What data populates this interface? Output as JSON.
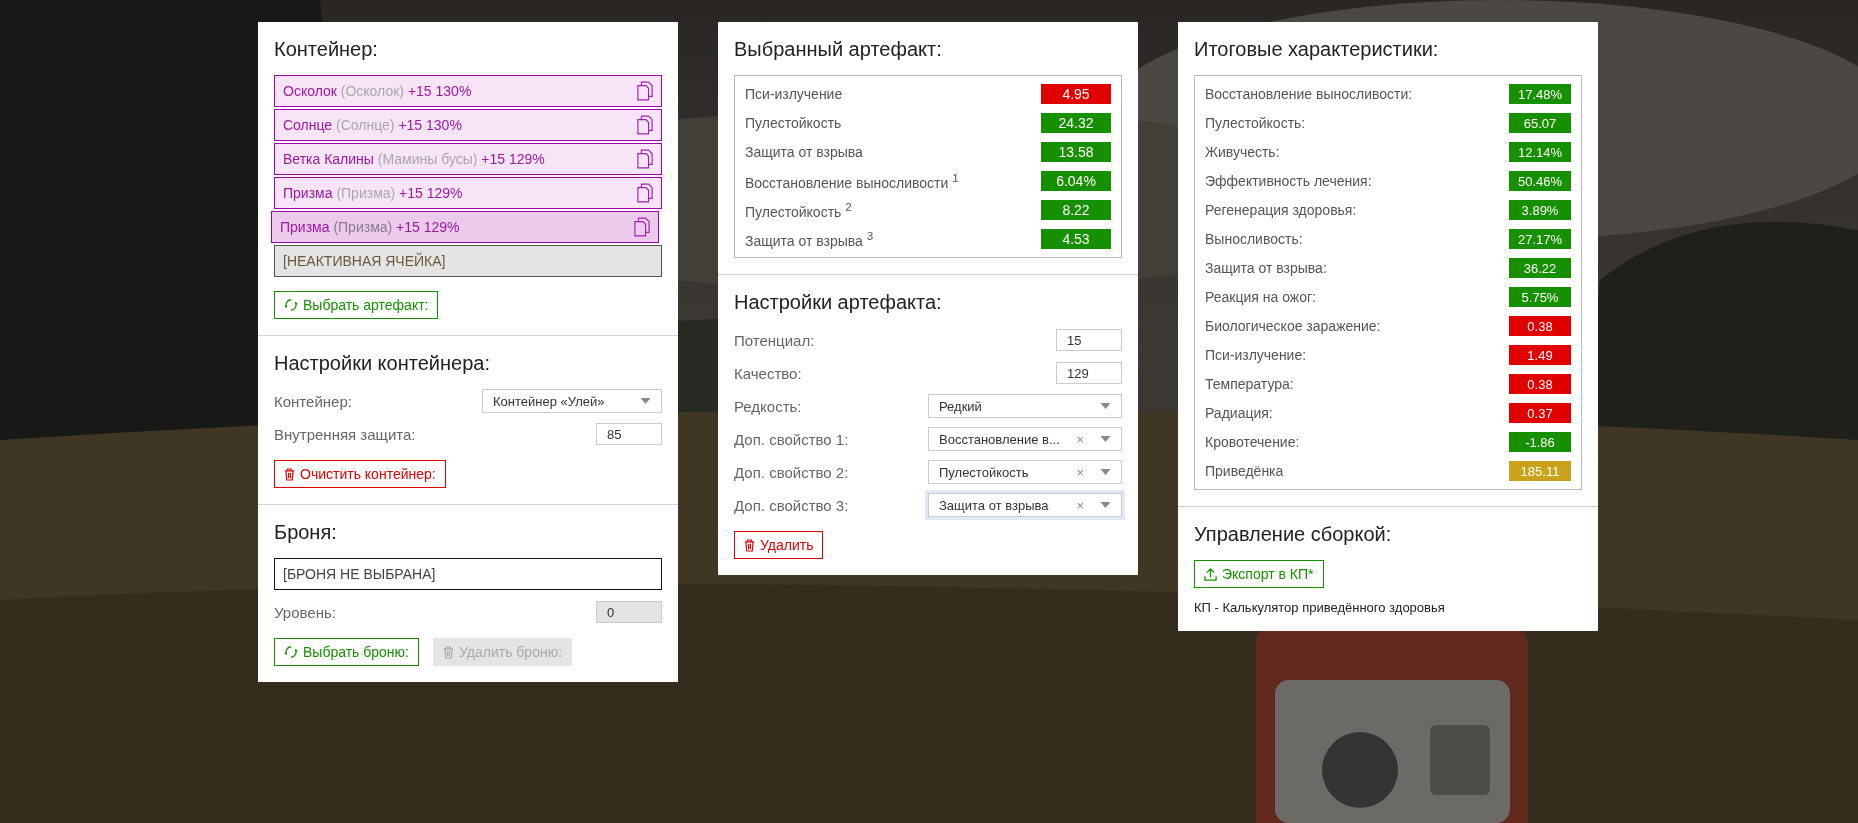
{
  "container_panel": {
    "title": "Контейнер:",
    "slots": [
      {
        "kind": "artifact",
        "name": "Осколок",
        "original": "(Осколок)",
        "stats": "+15 130%",
        "selected": false
      },
      {
        "kind": "artifact",
        "name": "Солнце",
        "original": "(Солнце)",
        "stats": "+15 130%",
        "selected": false
      },
      {
        "kind": "artifact",
        "name": "Ветка Калины",
        "original": "(Мамины бусы)",
        "stats": "+15 129%",
        "selected": false
      },
      {
        "kind": "artifact",
        "name": "Призма",
        "original": "(Призма)",
        "stats": "+15 129%",
        "selected": false
      },
      {
        "kind": "artifact",
        "name": "Призма",
        "original": "(Призма)",
        "stats": "+15 129%",
        "selected": true
      },
      {
        "kind": "inactive",
        "name": "[НЕАКТИВНАЯ ЯЧЕЙКА]"
      }
    ],
    "select_button": {
      "label": "Выбрать артефакт:",
      "kind": "green",
      "disabled": false
    }
  },
  "container_settings": {
    "title": "Настройки контейнера:",
    "fields": [
      {
        "kind": "select",
        "label": "Контейнер:",
        "value": "Контейнер «Улей»",
        "focused": false
      },
      {
        "kind": "input",
        "label": "Внутренняя защита:",
        "value": "85",
        "disabled": false
      }
    ],
    "clear_button": {
      "label": "Очистить контейнер:",
      "kind": "red",
      "disabled": false
    }
  },
  "armor": {
    "title": "Броня:",
    "value": "[БРОНЯ НЕ ВЫБРАНА]",
    "fields": [
      {
        "kind": "input",
        "label": "Уровень:",
        "value": "0",
        "disabled": true
      }
    ],
    "buttons": [
      {
        "label": "Выбрать броню:",
        "kind": "green",
        "disabled": false
      },
      {
        "label": "Удалить броню:",
        "kind": "red",
        "disabled": true
      }
    ]
  },
  "selected_artifact": {
    "title": "Выбранный артефакт:",
    "stats": [
      {
        "label": "Пси-излучение",
        "value": "4.95",
        "color": "#e00000"
      },
      {
        "label": "Пулестойкость",
        "value": "24.32",
        "color": "#179000"
      },
      {
        "label": "Защита от взрыва",
        "value": "13.58",
        "color": "#179000"
      },
      {
        "label": "Восстановление выносливости $^{1}$",
        "value": "6.04%",
        "color": "#179000"
      },
      {
        "label": "Пулестойкость $^{2}$",
        "value": "8.22",
        "color": "#179000"
      },
      {
        "label": "Защита от взрыва $^{3}$",
        "value": "4.53",
        "color": "#179000"
      }
    ]
  },
  "artifact_settings": {
    "title": "Настройки артефакта:",
    "fields": [
      {
        "kind": "input",
        "label": "Потенциал:",
        "value": "15",
        "disabled": false
      },
      {
        "kind": "input",
        "label": "Качество:",
        "value": "129",
        "disabled": false
      },
      {
        "kind": "select",
        "label": "Редкость:",
        "value": "Редкий",
        "focused": false
      },
      {
        "kind": "select",
        "label": "Доп. свойство 1:",
        "value": "Восстановление в...",
        "clear": "×",
        "focused": false
      },
      {
        "kind": "select",
        "label": "Доп. свойство 2:",
        "value": "Пулестойкость",
        "clear": "×",
        "focused": false
      },
      {
        "kind": "select",
        "label": "Доп. свойство 3:",
        "value": "Защита от взрыва",
        "clear": "×",
        "focused": true
      }
    ],
    "delete_button": {
      "label": "Удалить",
      "kind": "red",
      "disabled": false
    }
  },
  "totals": {
    "title": "Итоговые характеристики:",
    "stats": [
      {
        "label": "Восстановление выносливости:",
        "value": "17.48%",
        "color": "#179000"
      },
      {
        "label": "Пулестойкость:",
        "value": "65.07",
        "color": "#179000"
      },
      {
        "label": "Живучесть:",
        "value": "12.14%",
        "color": "#179000"
      },
      {
        "label": "Эффективность лечения:",
        "value": "50.46%",
        "color": "#179000"
      },
      {
        "label": "Регенерация здоровья:",
        "value": "3.89%",
        "color": "#179000"
      },
      {
        "label": "Выносливость:",
        "value": "27.17%",
        "color": "#179000"
      },
      {
        "label": "Защита от взрыва:",
        "value": "36.22",
        "color": "#179000"
      },
      {
        "label": "Реакция на ожог:",
        "value": "5.75%",
        "color": "#179000"
      },
      {
        "label": "Биологическое заражение:",
        "value": "0.38",
        "color": "#e00000"
      },
      {
        "label": "Пси-излучение:",
        "value": "1.49",
        "color": "#e00000"
      },
      {
        "label": "Температура:",
        "value": "0.38",
        "color": "#e00000"
      },
      {
        "label": "Радиация:",
        "value": "0.37",
        "color": "#e00000"
      },
      {
        "label": "Кровотечение:",
        "value": "-1.86",
        "color": "#179000"
      },
      {
        "label": "Приведёнка",
        "value": "185.11",
        "color": "#c9a21a"
      }
    ]
  },
  "build": {
    "title": "Управление сборкой:",
    "export_button": {
      "label": "Экспорт в КП*",
      "kind": "green",
      "disabled": false
    },
    "note": "КП - Калькулятор приведённого здоровья"
  }
}
